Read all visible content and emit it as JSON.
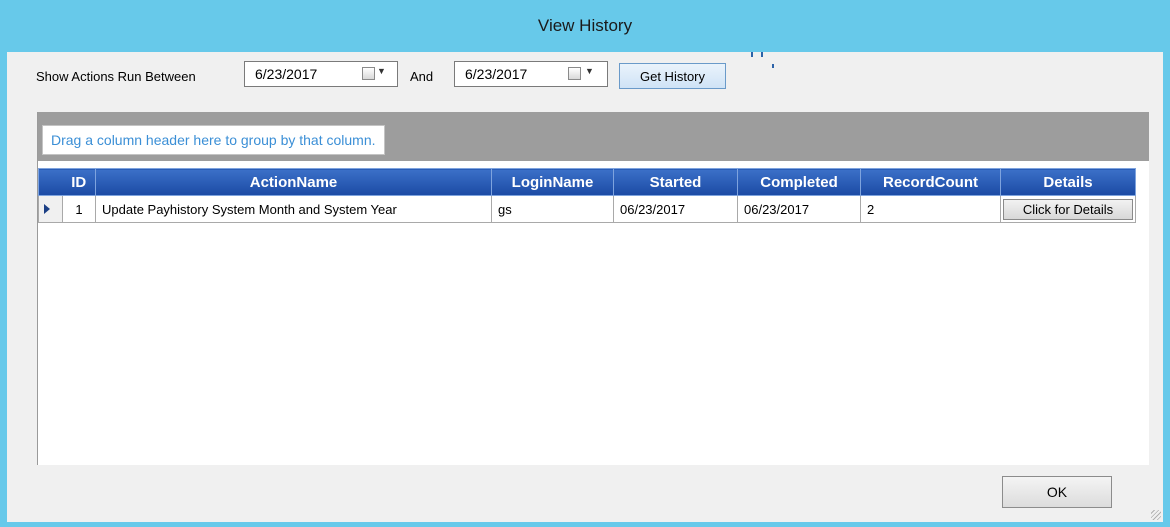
{
  "window": {
    "title": "View History"
  },
  "filter": {
    "show_label": "Show Actions Run Between",
    "start_date": "6/23/2017",
    "and_label": "And",
    "end_date": "6/23/2017",
    "get_history_label": "Get History"
  },
  "grid": {
    "group_hint": "Drag a column header here to group by that column.",
    "columns": [
      "ID",
      "ActionName",
      "LoginName",
      "Started",
      "Completed",
      "RecordCount",
      "Details"
    ],
    "rows": [
      {
        "id": "1",
        "action_name": "Update Payhistory System Month and System Year",
        "login_name": "gs",
        "started": "06/23/2017",
        "completed": "06/23/2017",
        "record_count": "2",
        "details_label": "Click for Details"
      }
    ]
  },
  "footer": {
    "ok_label": "OK"
  },
  "colors": {
    "titlebar": "#67c9ea",
    "header": "#1b4aa4",
    "group_panel": "#9d9d9d",
    "hint_text": "#3b8fd6"
  }
}
